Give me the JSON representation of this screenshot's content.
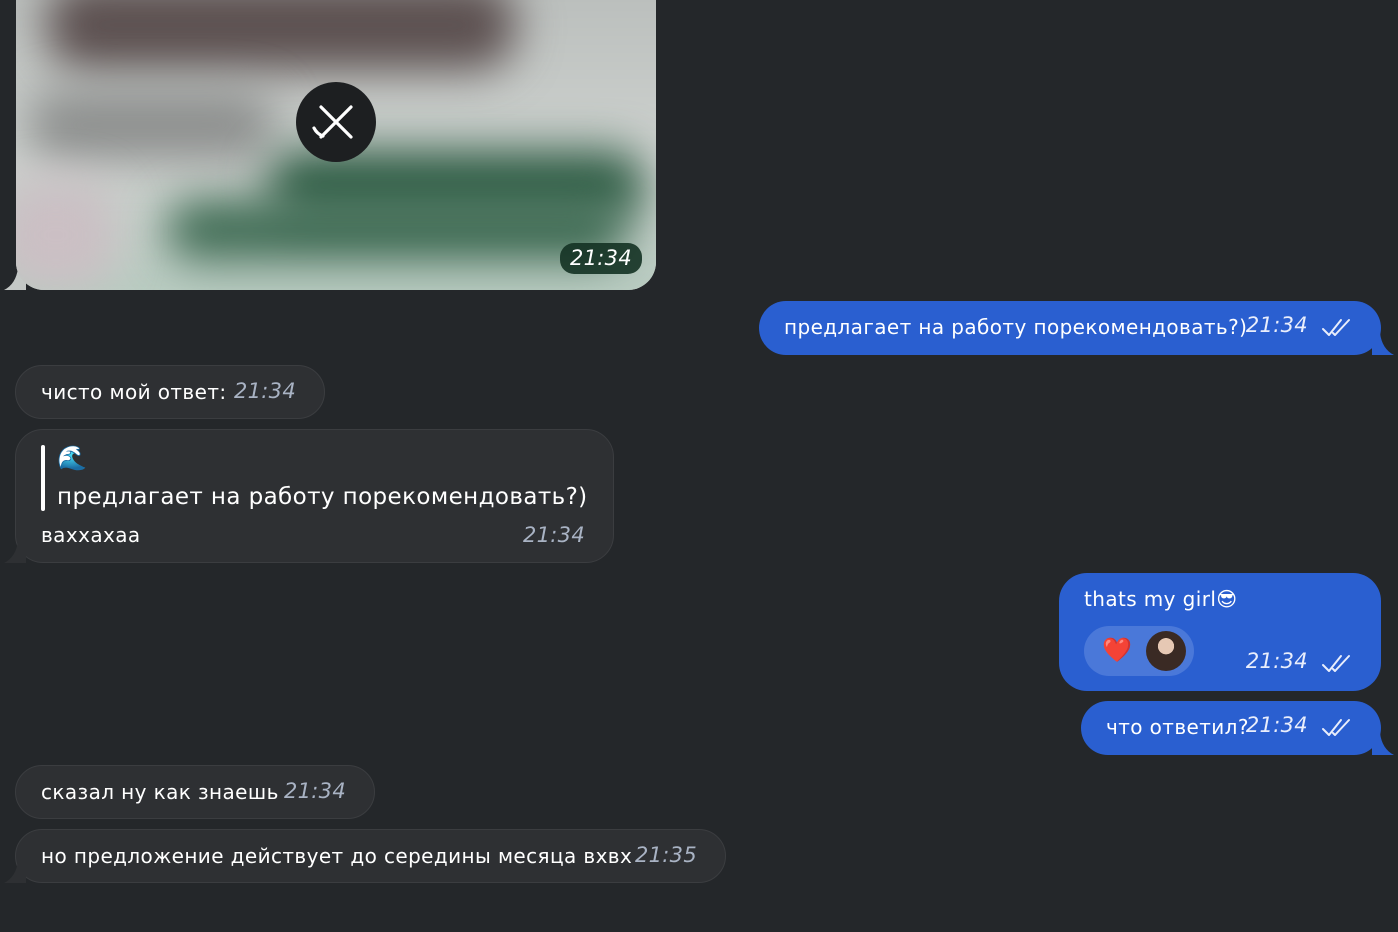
{
  "messages": {
    "media": {
      "time": "21:34"
    },
    "out1": {
      "text": "предлагает на работу порекомендовать?)",
      "time": "21:34"
    },
    "in1": {
      "text": "чисто мой ответ:",
      "time": "21:34"
    },
    "in2": {
      "quote_author_emoji": "🌊",
      "quote_text": "предлагает на работу порекомендовать?)",
      "text": "ваххахаа",
      "time": "21:34"
    },
    "out2": {
      "text": "thats my girl😎",
      "time": "21:34",
      "reaction": "❤️"
    },
    "out3": {
      "text": "что ответил?",
      "time": "21:34"
    },
    "in3": {
      "text": "сказал ну как знаешь",
      "time": "21:34"
    },
    "in4": {
      "text": "но предложение действует до середины месяца вхвх",
      "time": "21:35"
    }
  },
  "colors": {
    "background": "#24272a",
    "incoming_bubble": "#2e3033",
    "outgoing_bubble": "#2a5fd0",
    "reaction_chip": "#4a78d9"
  },
  "icons": {
    "media_cancel": "close-icon",
    "read_status": "double-check-icon"
  }
}
